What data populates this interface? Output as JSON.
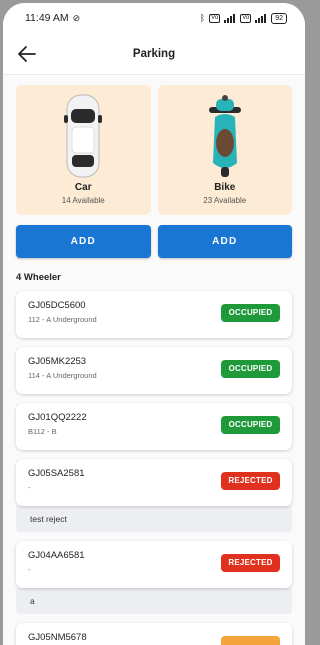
{
  "status_bar": {
    "time": "11:49 AM",
    "battery": "92"
  },
  "header": {
    "title": "Parking"
  },
  "vehicle_types": [
    {
      "name": "Car",
      "available": "14 Available"
    },
    {
      "name": "Bike",
      "available": "23 Available"
    }
  ],
  "add_buttons": [
    "ADD",
    "ADD"
  ],
  "section_title": "4 Wheeler",
  "colors": {
    "occupied": "#1e9a3a",
    "rejected": "#e0311f",
    "pending": "#f5a33c",
    "primary": "#1976d2",
    "card_bg": "#fdebd5"
  },
  "entries": [
    {
      "plate": "GJ05DC5600",
      "location": "112 - A Underground",
      "status": "OCCUPIED",
      "note": ""
    },
    {
      "plate": "GJ05MK2253",
      "location": "114 - A Underground",
      "status": "OCCUPIED",
      "note": ""
    },
    {
      "plate": "GJ01QQ2222",
      "location": "B112 - B",
      "status": "OCCUPIED",
      "note": ""
    },
    {
      "plate": "GJ05SA2581",
      "location": "-",
      "status": "REJECTED",
      "note": "test reject"
    },
    {
      "plate": "GJ04AA6581",
      "location": "-",
      "status": "REJECTED",
      "note": "a"
    },
    {
      "plate": "GJ05NM5678",
      "location": "",
      "status": "",
      "note": ""
    }
  ]
}
